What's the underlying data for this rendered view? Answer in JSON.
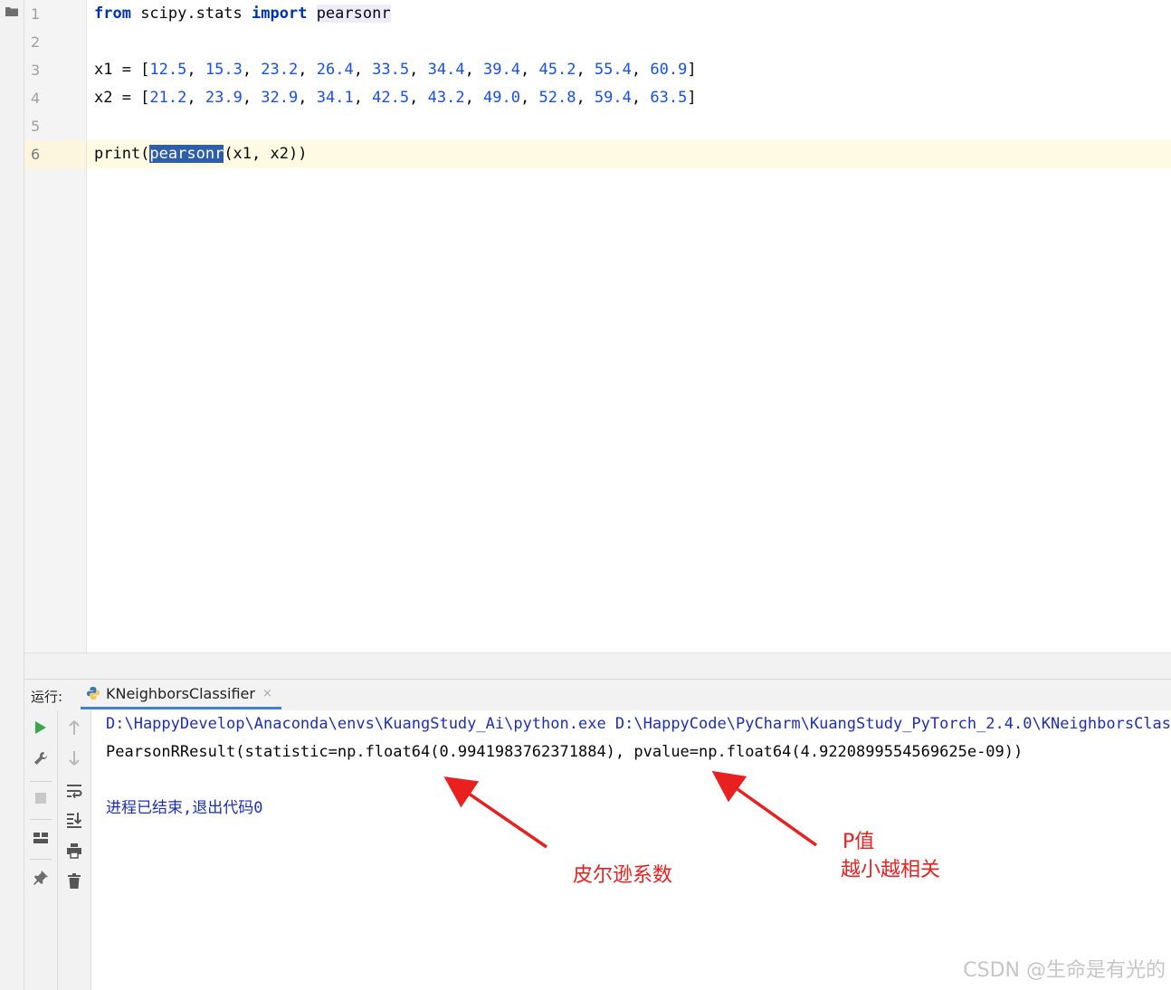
{
  "editor": {
    "line_numbers": [
      "1",
      "2",
      "3",
      "4",
      "5",
      "6"
    ],
    "line1": {
      "kw_from": "from",
      "module": " scipy.stats ",
      "kw_import": "import",
      "space": " ",
      "name": "pearsonr"
    },
    "line3": {
      "prefix": "x1 = [",
      "values": [
        "12.5",
        "15.3",
        "23.2",
        "26.4",
        "33.5",
        "34.4",
        "39.4",
        "45.2",
        "55.4",
        "60.9"
      ],
      "suffix": "]"
    },
    "line4": {
      "prefix": "x2 = [",
      "values": [
        "21.2",
        "23.9",
        "32.9",
        "34.1",
        "42.5",
        "43.2",
        "49.0",
        "52.8",
        "59.4",
        "63.5"
      ],
      "suffix": "]"
    },
    "line6": {
      "func": "print(",
      "selected": "pearsonr",
      "args": "(x1, x2))"
    }
  },
  "run_panel": {
    "label": "运行:",
    "tab_label": "KNeighborsClassifier",
    "tab_close": "×",
    "command_line": "D:\\HappyDevelop\\Anaconda\\envs\\KuangStudy_Ai\\python.exe D:\\HappyCode\\PyCharm\\KuangStudy_PyTorch_2.4.0\\KNeighborsClassifier.py",
    "result_line": "PearsonRResult(statistic=np.float64(0.9941983762371884), pvalue=np.float64(4.9220899554569625e-09))",
    "exit_line": "进程已结束,退出代码0",
    "toolbar_icons": [
      "run-icon",
      "wrench-icon",
      "stop-icon",
      "layout-icon",
      "pin-icon",
      "up-arrow-icon",
      "down-arrow-icon",
      "soft-wrap-icon",
      "scroll-to-end-icon",
      "print-icon",
      "trash-icon"
    ]
  },
  "annotations": {
    "label_coefficient": "皮尔逊系数",
    "label_p_line1": "P值",
    "label_p_line2": "越小越相关",
    "color": "#e8201f"
  },
  "watermark": "CSDN @生命是有光的"
}
